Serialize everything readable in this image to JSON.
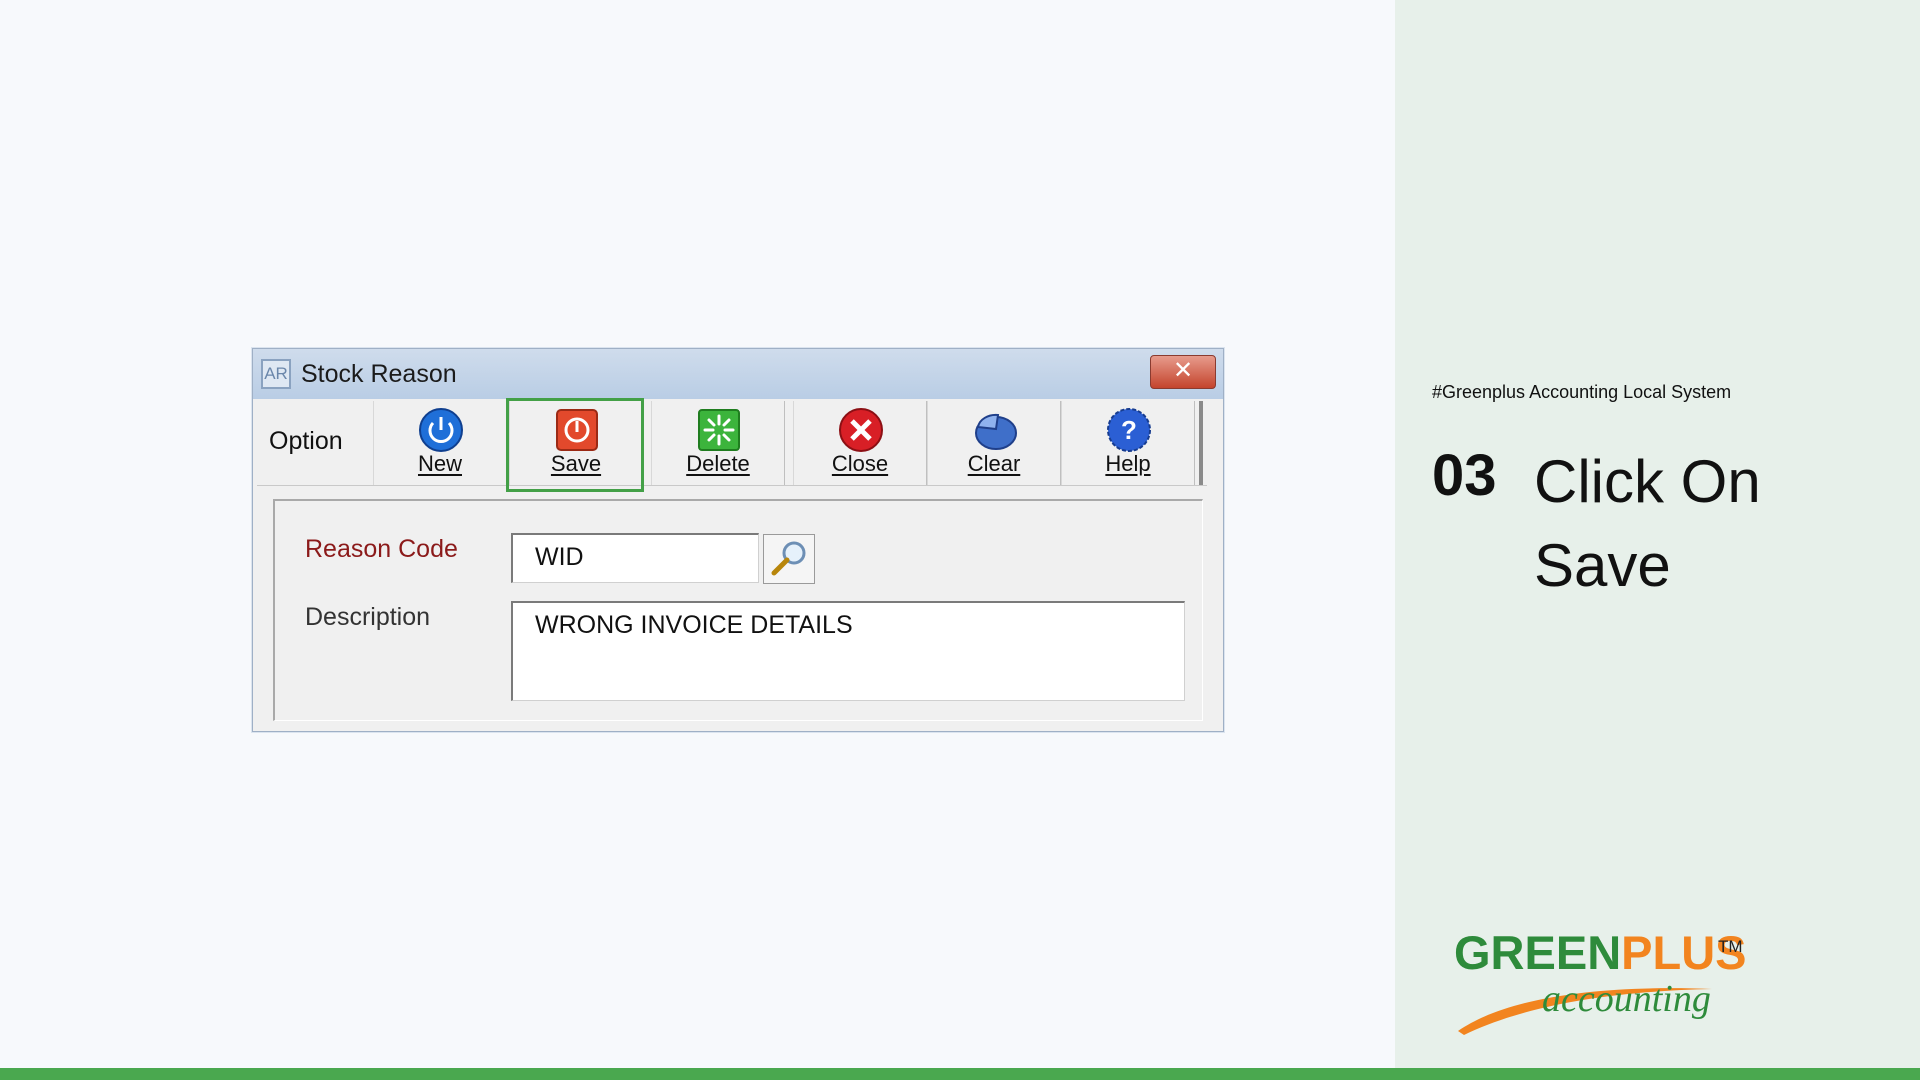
{
  "dialog": {
    "title": "Stock Reason",
    "app_icon_text": "AR",
    "close_symbol": "✕"
  },
  "toolbar": {
    "option_label": "Option",
    "buttons": [
      {
        "label": "New",
        "icon": "power-icon",
        "color": "#1f6fd8"
      },
      {
        "label": "Save",
        "icon": "save-power-icon",
        "color": "#e2492c"
      },
      {
        "label": "Delete",
        "icon": "delete-burst-icon",
        "color": "#3cb43c"
      },
      {
        "label": "Close",
        "icon": "close-circle-icon",
        "color": "#d81f26"
      },
      {
        "label": "Clear",
        "icon": "clear-pie-icon",
        "color": "#3f6fc9"
      },
      {
        "label": "Help",
        "icon": "help-icon",
        "color": "#2b5fd4"
      }
    ],
    "highlighted_button": "Save"
  },
  "form": {
    "reason_code_label": "Reason Code",
    "reason_code_value": "WID",
    "description_label": "Description",
    "description_value": "WRONG INVOICE DETAILS"
  },
  "side": {
    "tagline": "#Greenplus Accounting Local System",
    "step_number": "03",
    "step_text": "Click On Save"
  },
  "logo": {
    "part1": "GREEN",
    "part2": "PLUS",
    "tm": "TM",
    "sub": "accounting",
    "green": "#2e8b3b",
    "orange": "#f2841f"
  }
}
